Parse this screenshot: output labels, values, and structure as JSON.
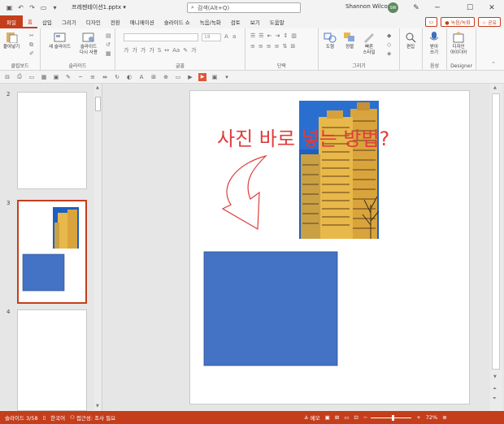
{
  "titlebar": {
    "filename": "프레젠테이션1.pptx ▾",
    "search_placeholder": "검색(Alt+Q)",
    "user_name": "Shannon Wilcox",
    "user_initials": "SW",
    "minimize": "─",
    "maximize": "☐",
    "close": "✕"
  },
  "tabs": [
    "파일",
    "홈",
    "삽입",
    "그리기",
    "디자인",
    "전환",
    "애니메이션",
    "슬라이드 쇼",
    "녹음/녹화",
    "검토",
    "보기",
    "도움말"
  ],
  "active_tab_index": 1,
  "tab_right": {
    "record": "● 녹음/녹화",
    "share": "☆ 공유"
  },
  "ribbon": {
    "clipboard": {
      "paste": "붙여넣기",
      "label": "클립보드"
    },
    "slides": {
      "new_slide": "새 슬라이드",
      "reuse_slide_1": "슬라이드",
      "reuse_slide_2": "다시 사용",
      "label": "슬라이드"
    },
    "font": {
      "label": "글꼴",
      "size": "18"
    },
    "paragraph": {
      "label": "단락"
    },
    "drawing": {
      "shapes": "도형",
      "arrange": "정렬",
      "quick_styles_1": "빠른",
      "quick_styles_2": "스타일",
      "label": "그리기"
    },
    "editing": {
      "edit": "편집"
    },
    "voice": {
      "dictate_1": "받아",
      "dictate_2": "쓰기",
      "label": "음성"
    },
    "designer": {
      "ideas_1": "디자인",
      "ideas_2": "아이디어",
      "label": "Designer"
    }
  },
  "slides_pane": {
    "numbers": [
      "2",
      "3",
      "4"
    ]
  },
  "slide": {
    "text": "사진 바로 넣는 방법?"
  },
  "status": {
    "slide_count": "슬라이드 3/58",
    "language": "한국어",
    "accessibility": "접근성: 조사 필요",
    "notes": "≙ 메모",
    "zoom": "72%"
  },
  "colors": {
    "accent": "#c43e1c",
    "shape_blue": "#4472c4",
    "arrow_red": "#e03c3c",
    "building_yellow": "#e8b84a",
    "sky_blue": "#1e5fc0"
  }
}
